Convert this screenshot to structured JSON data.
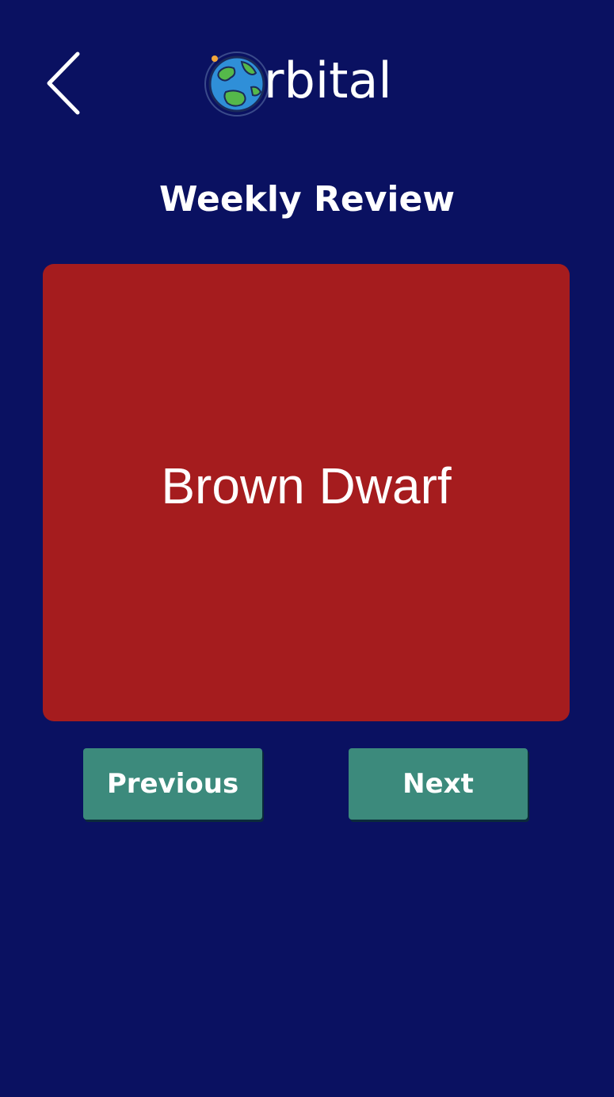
{
  "header": {
    "back_icon": "chevron-left-icon",
    "logo_icon": "earth-globe-icon",
    "logo_text": "rbital"
  },
  "page": {
    "title": "Weekly Review"
  },
  "flashcard": {
    "term": "Brown Dwarf"
  },
  "navigation": {
    "previous_label": "Previous",
    "next_label": "Next"
  },
  "colors": {
    "background": "#0a1161",
    "card": "#a51c1e",
    "button": "#3c8a7c",
    "text": "#ffffff"
  }
}
